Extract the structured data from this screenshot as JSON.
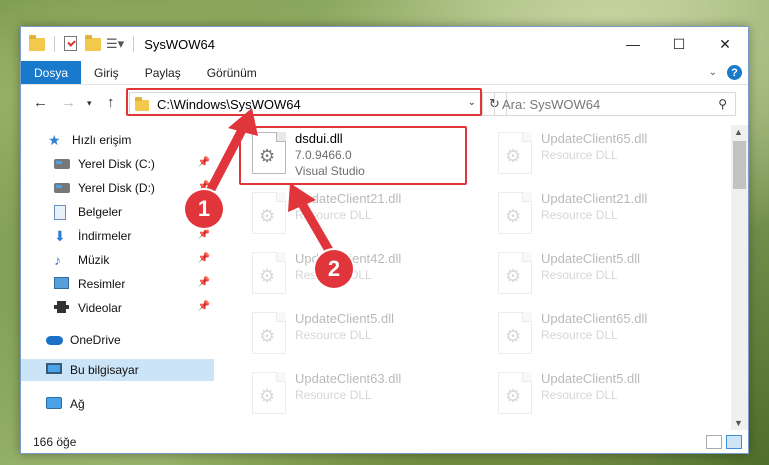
{
  "window": {
    "title": "SysWOW64"
  },
  "window_controls": {
    "minimize": "—",
    "maximize": "☐",
    "close": "✕"
  },
  "ribbon": {
    "tabs": [
      {
        "label": "Dosya",
        "active": true
      },
      {
        "label": "Giriş",
        "active": false
      },
      {
        "label": "Paylaş",
        "active": false
      },
      {
        "label": "Görünüm",
        "active": false
      }
    ],
    "help": "?"
  },
  "address": {
    "path": "C:\\Windows\\SysWOW64"
  },
  "search": {
    "placeholder": "Ara: SysWOW64"
  },
  "sidebar": {
    "items": [
      {
        "label": "Hızlı erişim",
        "icon": "star-icon",
        "pinned": false
      },
      {
        "label": "Yerel Disk (C:)",
        "icon": "drive-icon",
        "pinned": true
      },
      {
        "label": "Yerel Disk (D:)",
        "icon": "drive-icon",
        "pinned": true
      },
      {
        "label": "Belgeler",
        "icon": "document-icon",
        "pinned": true
      },
      {
        "label": "İndirmeler",
        "icon": "download-icon",
        "pinned": true
      },
      {
        "label": "Müzik",
        "icon": "music-icon",
        "pinned": true
      },
      {
        "label": "Resimler",
        "icon": "pictures-icon",
        "pinned": true
      },
      {
        "label": "Videolar",
        "icon": "videos-icon",
        "pinned": true
      },
      {
        "label": "OneDrive",
        "icon": "onedrive-icon",
        "pinned": false
      },
      {
        "label": "Bu bilgisayar",
        "icon": "computer-icon",
        "pinned": false,
        "selected": true
      },
      {
        "label": "Ağ",
        "icon": "network-icon",
        "pinned": false
      }
    ]
  },
  "files": [
    {
      "name": "dsdui.dll",
      "sub1": "7.0.9466.0",
      "sub2": "Visual Studio",
      "faded": false
    },
    {
      "name": "UpdateClient65.dll",
      "sub1": "Resource DLL",
      "sub2": "",
      "faded": true
    },
    {
      "name": "UpdateClient21.dll",
      "sub1": "Resource DLL",
      "sub2": "",
      "faded": true
    },
    {
      "name": "UpdateClient21.dll",
      "sub1": "Resource DLL",
      "sub2": "",
      "faded": true
    },
    {
      "name": "UpdateClient42.dll",
      "sub1": "Resource DLL",
      "sub2": "",
      "faded": true
    },
    {
      "name": "UpdateClient5.dll",
      "sub1": "Resource DLL",
      "sub2": "",
      "faded": true
    },
    {
      "name": "UpdateClient5.dll",
      "sub1": "Resource DLL",
      "sub2": "",
      "faded": true
    },
    {
      "name": "UpdateClient65.dll",
      "sub1": "Resource DLL",
      "sub2": "",
      "faded": true
    },
    {
      "name": "UpdateClient63.dll",
      "sub1": "Resource DLL",
      "sub2": "",
      "faded": true
    },
    {
      "name": "UpdateClient5.dll",
      "sub1": "Resource DLL",
      "sub2": "",
      "faded": true
    }
  ],
  "status": {
    "count": "166 öğe"
  },
  "annotations": {
    "badge1": "1",
    "badge2": "2",
    "color": "#e0353b"
  }
}
